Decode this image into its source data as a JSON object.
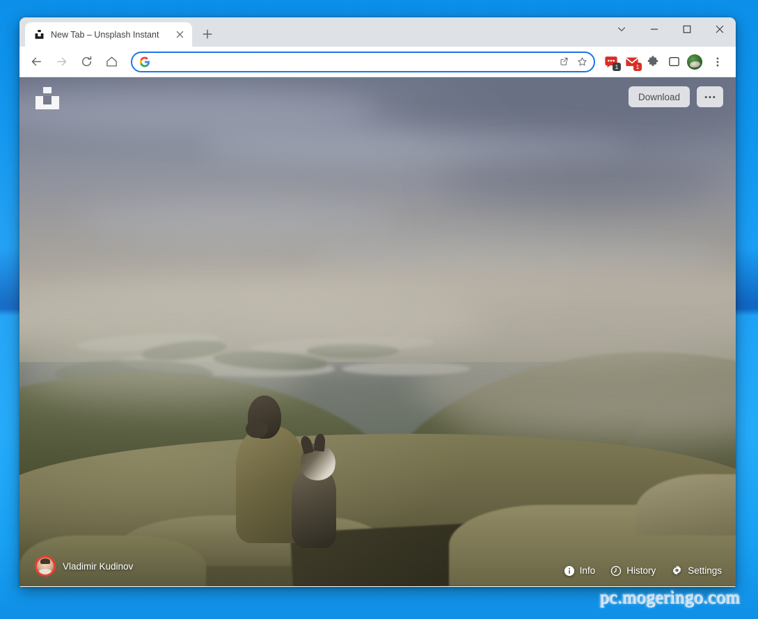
{
  "window": {
    "tab": {
      "title": "New Tab – Unsplash Instant",
      "favicon_name": "unsplash-favicon",
      "close_label": "✕"
    },
    "new_tab_label": "+",
    "controls": {
      "tab_search_label": "⌄",
      "minimize_label": "—",
      "maximize_label": "□",
      "close_label": "✕"
    }
  },
  "toolbar": {
    "back_label": "←",
    "forward_label": "→",
    "reload_label": "⟳",
    "home_label": "⌂",
    "omnibox": {
      "value": "",
      "placeholder": "",
      "search_engine_icon": "google-g-icon",
      "share_icon": "share-icon",
      "bookmark_icon": "star-icon"
    },
    "extensions": [
      {
        "name": "chat-extension-icon",
        "badge": "1",
        "badge_color": "#3c4043",
        "color": "#dd2b26"
      },
      {
        "name": "gmail-extension-icon",
        "badge": "1",
        "badge_color": "#d93025",
        "color": "#d93025"
      },
      {
        "name": "extensions-puzzle-icon",
        "badge": "",
        "badge_color": "",
        "color": "#5f6368"
      },
      {
        "name": "side-panel-icon",
        "badge": "",
        "badge_color": "",
        "color": "#5f6368"
      }
    ],
    "profile_avatar_name": "profile-avatar",
    "menu_label": "⋮"
  },
  "page": {
    "logo_name": "unsplash-logo",
    "download_label": "Download",
    "more_label": "•••",
    "photographer": "Vladimir Kudinov",
    "actions": [
      {
        "label": "Info",
        "icon": "info-icon"
      },
      {
        "label": "History",
        "icon": "history-clock-icon"
      },
      {
        "label": "Settings",
        "icon": "gear-icon"
      }
    ],
    "photo_description": "Person in olive jacket sitting with a husky dog on a mossy granite summit above a foggy forested valley and lake"
  },
  "desktop": {
    "watermark": "pc.mogeringo.com",
    "accent_blue": "#1ea2f7",
    "band_blue": "#1168c6"
  }
}
